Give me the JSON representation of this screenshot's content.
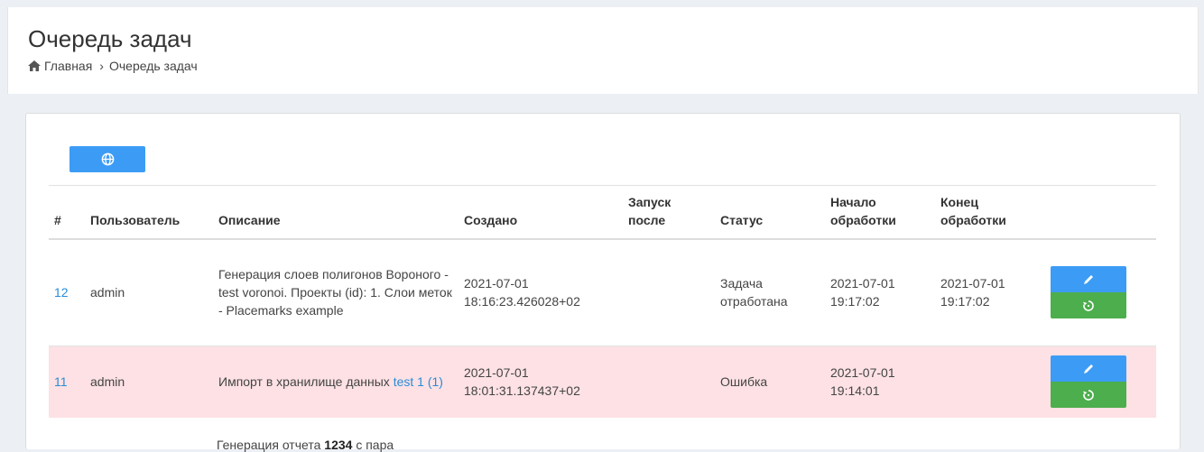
{
  "page": {
    "title": "Очередь задач",
    "breadcrumb": {
      "home": "Главная",
      "separator": "›",
      "current": "Очередь задач"
    }
  },
  "toolbar": {
    "globe_icon": "globe-icon"
  },
  "table": {
    "headers": {
      "id": "#",
      "user": "Пользователь",
      "description": "Описание",
      "created": "Создано",
      "run_after_1": "Запуск",
      "run_after_2": "после",
      "status": "Статус",
      "start_1": "Начало",
      "start_2": "обработки",
      "end_1": "Конец",
      "end_2": "обработки"
    },
    "rows": [
      {
        "id": "12",
        "user": "admin",
        "description": "Генерация слоев полигонов Вороного - test voronoi. Проекты (id): 1. Слои меток - Placemarks example",
        "created": "2021-07-01 18:16:23.426028+02",
        "run_after": "",
        "status": "Задача отработана",
        "start": "2021-07-01 19:17:02",
        "end": "2021-07-01 19:17:02"
      },
      {
        "id": "11",
        "user": "admin",
        "description_prefix": "Импорт в хранилище данных ",
        "description_link": "test 1 (1)",
        "created": "2021-07-01 18:01:31.137437+02",
        "run_after": "",
        "status": "Ошибка",
        "start": "2021-07-01 19:14:01",
        "end": ""
      }
    ],
    "partial_row": {
      "prefix": "Генерация отчета ",
      "bold": "1234",
      "suffix": " с пара"
    }
  },
  "colors": {
    "primary": "#3c9cf5",
    "success": "#4cae4c",
    "error_row": "#fde1e5",
    "link": "#2a8cd6"
  }
}
